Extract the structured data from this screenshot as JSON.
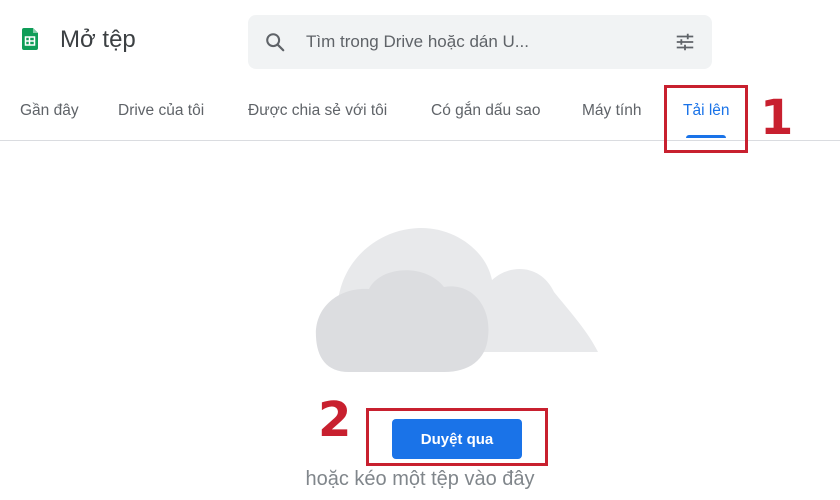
{
  "header": {
    "title": "Mở tệp",
    "app_icon": "sheets-icon",
    "app_icon_color": "#0f9d58"
  },
  "search": {
    "placeholder": "Tìm trong Drive hoặc dán U...",
    "search_icon": "search-icon",
    "filter_icon": "tune-icon"
  },
  "tabs": [
    {
      "label": "Gần đây",
      "active": false
    },
    {
      "label": "Drive của tôi",
      "active": false
    },
    {
      "label": "Được chia sẻ với tôi",
      "active": false
    },
    {
      "label": "Có gắn dấu sao",
      "active": false
    },
    {
      "label": "Máy tính",
      "active": false
    },
    {
      "label": "Tải lên",
      "active": true
    }
  ],
  "upload": {
    "browse_label": "Duyệt qua",
    "drop_text": "hoặc kéo một tệp vào đây",
    "illustration": "cloud-icon"
  },
  "annotations": {
    "step1": "1",
    "step2": "2",
    "color": "#c8202f"
  },
  "colors": {
    "accent": "#1a73e8",
    "search_bg": "#f1f3f4"
  }
}
